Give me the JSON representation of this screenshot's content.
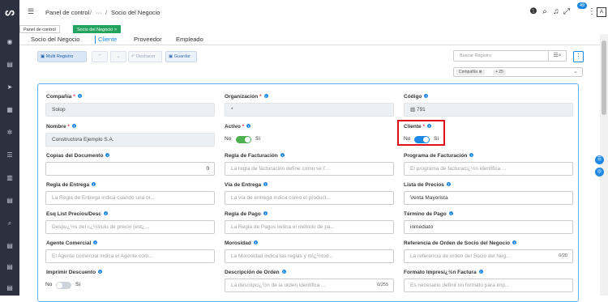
{
  "header": {
    "breadcrumb_home": "Panel de control",
    "breadcrumb_sep": "/",
    "breadcrumb_dots": "···",
    "breadcrumb_current": "Socio del Negocio",
    "notification_count": "49",
    "avatar_label": "A"
  },
  "window_tabs": [
    {
      "label": "Panel de control"
    },
    {
      "label": "Socio del Negocio ×"
    }
  ],
  "sub_tabs": [
    {
      "label": "Socio del Negocio"
    },
    {
      "label": "Cliente"
    },
    {
      "label": "Proveedor"
    },
    {
      "label": "Empleado"
    }
  ],
  "toolbar": {
    "multi_label": "Multi Registro",
    "undo_label": "Deshacer",
    "save_label": "Guardar"
  },
  "search": {
    "placeholder": "Buscar Registro"
  },
  "filter": {
    "chip1": "Compañía",
    "chip2": "+ 25"
  },
  "fields": {
    "company": {
      "label": "Compañía",
      "value": "Solop"
    },
    "org": {
      "label": "Organización",
      "value": "*"
    },
    "code": {
      "label": "Código",
      "value": "791"
    },
    "name": {
      "label": "Nombre",
      "value": "Constructora Ejemplo S.A."
    },
    "active": {
      "label": "Activo",
      "off": "No",
      "on": "Sí"
    },
    "customer": {
      "label": "Cliente",
      "off": "No",
      "on": "Sí"
    },
    "copies": {
      "label": "Copias del Documento",
      "value": "0"
    },
    "invoice_rule": {
      "label": "Regla de Facturación",
      "placeholder": "La regla de facturación define cómo se f..."
    },
    "invoice_schedule": {
      "label": "Programa de Facturación",
      "placeholder": "El programa de facturaci¿½n identifica ..."
    },
    "delivery_rule": {
      "label": "Regla de Entrega",
      "placeholder": "La Regla de Entrega indica cuando una or..."
    },
    "delivery_via": {
      "label": "Vía de Entrega",
      "placeholder": "La vía de entrega indica como el product..."
    },
    "price_list": {
      "label": "Lista de Precios",
      "value": "Venta Mayorista"
    },
    "discount_schema": {
      "label": "Esq List Precios/Desc",
      "placeholder": "Despu¿½s del c¿½lculo de precio (est¿..."
    },
    "payment_rule": {
      "label": "Regla de Pago",
      "placeholder": "La Regla de Pagos indica el método de pa..."
    },
    "payment_term": {
      "label": "Término de Pago",
      "value": "inmediato"
    },
    "sales_rep": {
      "label": "Agente Comercial",
      "placeholder": "El Agente comercial indica el Agente com..."
    },
    "dunning": {
      "label": "Morosidad",
      "placeholder": "La Morosidad indica las reglas y mï¿½tod..."
    },
    "order_ref": {
      "label": "Referencia de Orden de Socio del Negocio",
      "placeholder": "La referencia de orden del Socio del Neg...",
      "count": "0/20"
    },
    "print_discount": {
      "label": "Imprimir Descuento",
      "off": "No",
      "on": "Sí"
    },
    "order_desc": {
      "label": "Descripción de Orden",
      "placeholder": "La descripci¿½n de la orden identifica ...",
      "count": "0/255"
    },
    "invoice_format": {
      "label": "Formato Impresi¿½n Factura",
      "placeholder": "Es necesario definir un formato para imp..."
    }
  },
  "colors": {
    "sidebar": "#2c3140",
    "accent": "#1e88e5",
    "green": "#25a35e",
    "highlight": "#e0101a"
  }
}
